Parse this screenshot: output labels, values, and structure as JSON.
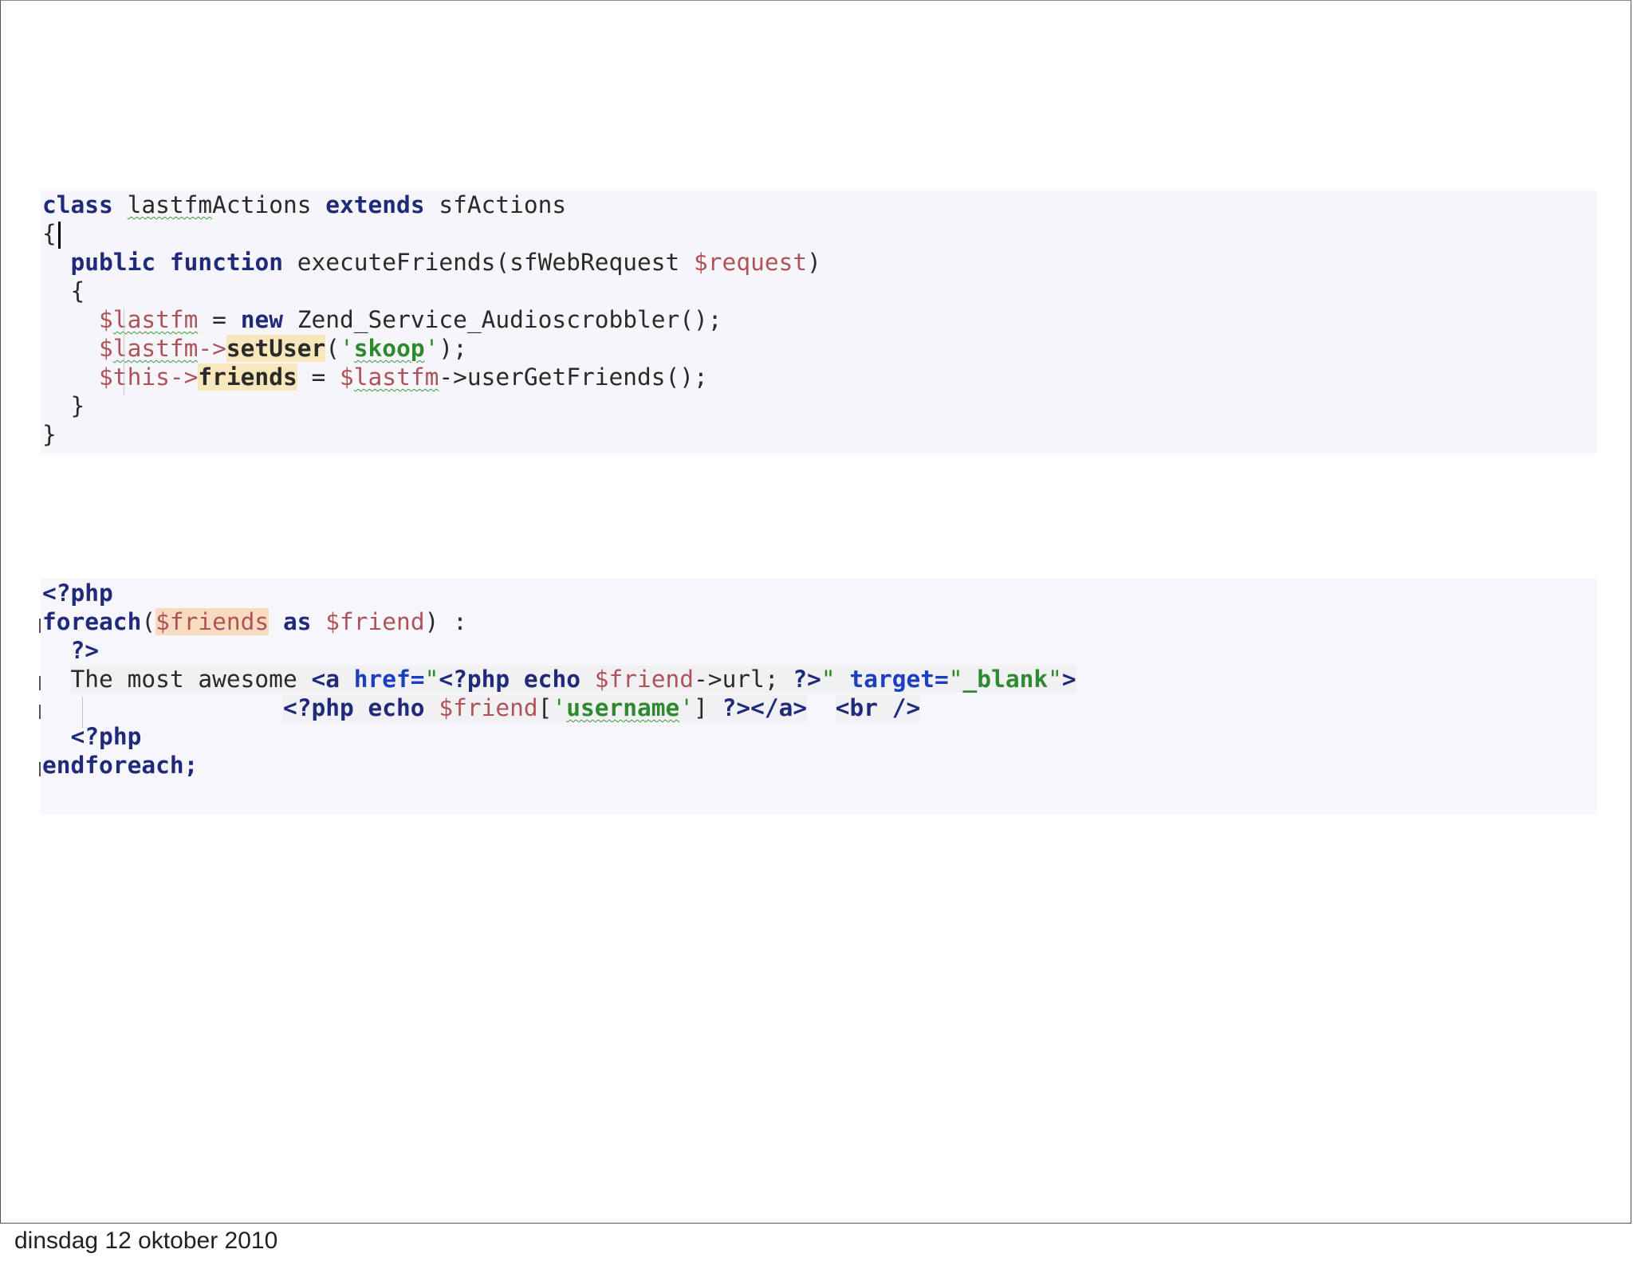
{
  "slide": {
    "footer_date": "dinsdag 12 oktober 2010"
  },
  "code1": {
    "class_kw": "class",
    "class_name_a": "lastfm",
    "class_name_b": "Actions",
    "extends_kw": "extends",
    "parent_class": "sfActions",
    "open_brace": "{",
    "public_kw": "public",
    "function_kw": "function",
    "method_name": "executeFriends(sfWebRequest ",
    "param": "$request",
    "close_paren": ")",
    "inner_open": "{",
    "l5_var_dollar": "$",
    "l5_var_name": "lastfm",
    "l5_eq": " = ",
    "l5_new_kw": "new",
    "l5_rest": " Zend_Service_Audioscrobbler();",
    "l6_var_dollar": "$",
    "l6_var_name": "lastfm",
    "l6_arrow": "->",
    "l6_method": "setUser",
    "l6_open": "(",
    "l6_q1": "'",
    "l6_str": "skoop",
    "l6_q2": "'",
    "l6_close": ");",
    "l7_this": "$this",
    "l7_arrow": "->",
    "l7_prop": "friends",
    "l7_eq": " = ",
    "l7_dollar": "$",
    "l7_var": "lastfm",
    "l7_rest": "->userGetFriends();",
    "inner_close": "}",
    "outer_close": "}"
  },
  "code2": {
    "php_open": "<?php",
    "foreach_kw": "foreach",
    "foreach_open": "(",
    "friends_var": "$friends",
    "as_kw": "as",
    "friend_var": "$friend",
    "foreach_close": ") :",
    "php_close": "?>",
    "text_lead": "The most awesome ",
    "a_open": "<a",
    "href_attr": " href=",
    "href_q1": "\"",
    "href_php": "<?php",
    "href_echo": " echo ",
    "href_var": "$friend",
    "href_rest": "->url; ",
    "href_php_close": "?>",
    "href_q2": "\"",
    "target_attr": " target=",
    "target_q1": "\"",
    "target_val": "_blank",
    "target_q2": "\"",
    "a_gt": ">",
    "l5_php": "<?php",
    "l5_echo": " echo ",
    "l5_var": "$friend",
    "l5_br1": "[",
    "l5_q1": "'",
    "l5_str": "username",
    "l5_q2": "'",
    "l5_br2": "] ",
    "l5_php_close": "?>",
    "l5_a_close": "</a>",
    "l5_br_tag": "<br />",
    "php_open2": "<?php",
    "endforeach_kw": "endforeach;"
  }
}
